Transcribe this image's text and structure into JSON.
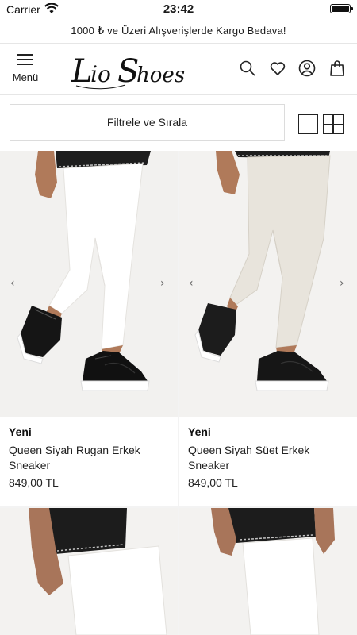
{
  "status_bar": {
    "carrier": "Carrier",
    "time": "23:42"
  },
  "announcement": "1000 ₺ ve Üzeri Alışverişlerde Kargo Bedava!",
  "header": {
    "menu_label": "Menü",
    "brand": "Lio Shoes",
    "icons": [
      "search-icon",
      "heart-icon",
      "account-icon",
      "bag-icon"
    ]
  },
  "filter": {
    "label": "Filtrele ve Sırala"
  },
  "products": [
    {
      "badge": "Yeni",
      "name": "Queen Siyah Rugan Erkek Sneaker",
      "price": "849,00 TL"
    },
    {
      "badge": "Yeni",
      "name": "Queen Siyah Süet Erkek Sneaker",
      "price": "849,00 TL"
    }
  ],
  "colors": {
    "text": "#1a1a1a",
    "border": "#dcdcdc",
    "bg": "#ffffff"
  }
}
